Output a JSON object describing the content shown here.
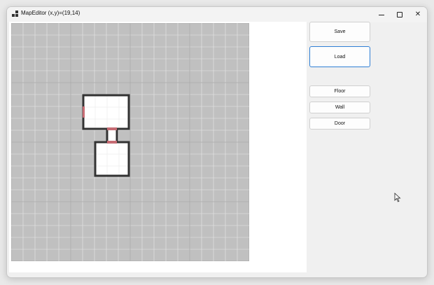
{
  "window": {
    "title": "MapEditor (x,y)=(19,14)",
    "icons": {
      "app": "app-icon",
      "minimize": "minimize-icon",
      "maximize": "maximize-icon",
      "close": "close-icon"
    }
  },
  "toolbar": {
    "save_label": "Save",
    "load_label": "Load"
  },
  "tools": {
    "floor_label": "Floor",
    "wall_label": "Wall",
    "door_label": "Door"
  },
  "map": {
    "columns": 20,
    "rows": 20,
    "colors": {
      "empty": "#c0c0c0",
      "floor": "#ffffff",
      "wall": "#333333",
      "door": "#c66b73",
      "gridline": "#e8e8e8"
    }
  }
}
